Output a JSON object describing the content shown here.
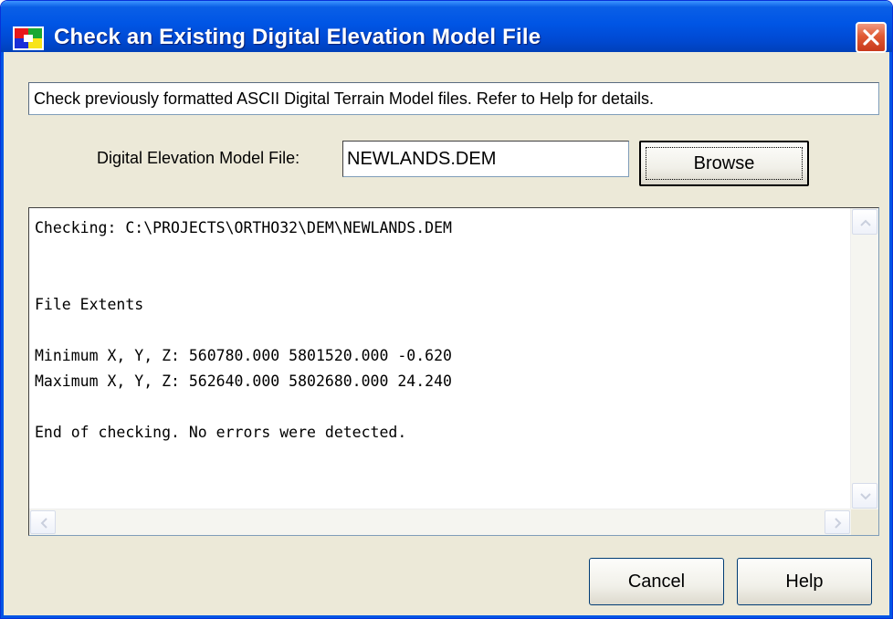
{
  "window": {
    "title": "Check an Existing Digital Elevation Model File",
    "app_icon": "application-icon",
    "close_icon": "close-icon",
    "colors": {
      "titlebar": "#0055e5",
      "close": "#e05a34",
      "face": "#ece9d8"
    }
  },
  "description": "Check previously formatted ASCII Digital Terrain Model files. Refer to Help for details.",
  "file": {
    "label": "Digital Elevation Model File:",
    "value": "NEWLANDS.DEM",
    "browse_label": "Browse"
  },
  "output": {
    "lines": [
      "Checking: C:\\PROJECTS\\ORTHO32\\DEM\\NEWLANDS.DEM",
      "",
      "",
      "File Extents",
      "",
      "Minimum X, Y, Z: 560780.000 5801520.000 -0.620",
      "Maximum X, Y, Z: 562640.000 5802680.000 24.240",
      "",
      "End of checking. No errors were detected."
    ]
  },
  "buttons": {
    "cancel_label": "Cancel",
    "help_label": "Help"
  }
}
